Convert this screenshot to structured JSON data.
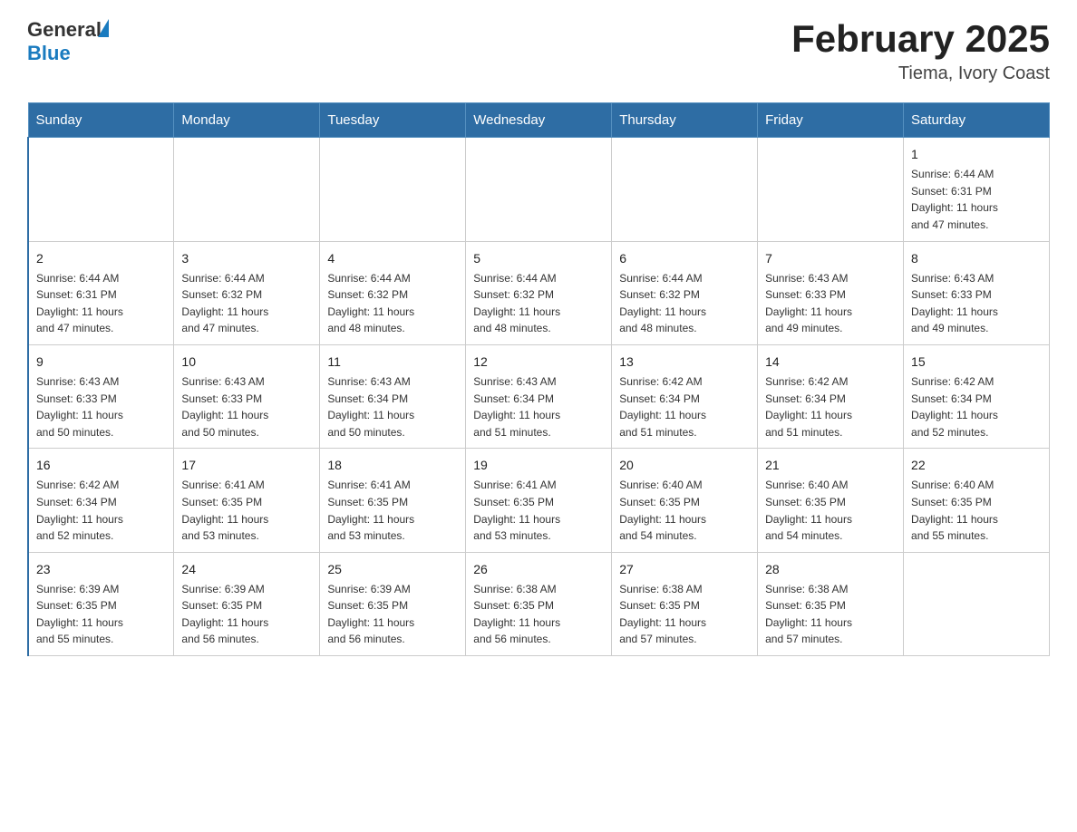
{
  "header": {
    "logo_general": "General",
    "logo_blue": "Blue",
    "title": "February 2025",
    "subtitle": "Tiema, Ivory Coast"
  },
  "weekdays": [
    "Sunday",
    "Monday",
    "Tuesday",
    "Wednesday",
    "Thursday",
    "Friday",
    "Saturday"
  ],
  "weeks": [
    [
      {
        "day": "",
        "info": ""
      },
      {
        "day": "",
        "info": ""
      },
      {
        "day": "",
        "info": ""
      },
      {
        "day": "",
        "info": ""
      },
      {
        "day": "",
        "info": ""
      },
      {
        "day": "",
        "info": ""
      },
      {
        "day": "1",
        "info": "Sunrise: 6:44 AM\nSunset: 6:31 PM\nDaylight: 11 hours\nand 47 minutes."
      }
    ],
    [
      {
        "day": "2",
        "info": "Sunrise: 6:44 AM\nSunset: 6:31 PM\nDaylight: 11 hours\nand 47 minutes."
      },
      {
        "day": "3",
        "info": "Sunrise: 6:44 AM\nSunset: 6:32 PM\nDaylight: 11 hours\nand 47 minutes."
      },
      {
        "day": "4",
        "info": "Sunrise: 6:44 AM\nSunset: 6:32 PM\nDaylight: 11 hours\nand 48 minutes."
      },
      {
        "day": "5",
        "info": "Sunrise: 6:44 AM\nSunset: 6:32 PM\nDaylight: 11 hours\nand 48 minutes."
      },
      {
        "day": "6",
        "info": "Sunrise: 6:44 AM\nSunset: 6:32 PM\nDaylight: 11 hours\nand 48 minutes."
      },
      {
        "day": "7",
        "info": "Sunrise: 6:43 AM\nSunset: 6:33 PM\nDaylight: 11 hours\nand 49 minutes."
      },
      {
        "day": "8",
        "info": "Sunrise: 6:43 AM\nSunset: 6:33 PM\nDaylight: 11 hours\nand 49 minutes."
      }
    ],
    [
      {
        "day": "9",
        "info": "Sunrise: 6:43 AM\nSunset: 6:33 PM\nDaylight: 11 hours\nand 50 minutes."
      },
      {
        "day": "10",
        "info": "Sunrise: 6:43 AM\nSunset: 6:33 PM\nDaylight: 11 hours\nand 50 minutes."
      },
      {
        "day": "11",
        "info": "Sunrise: 6:43 AM\nSunset: 6:34 PM\nDaylight: 11 hours\nand 50 minutes."
      },
      {
        "day": "12",
        "info": "Sunrise: 6:43 AM\nSunset: 6:34 PM\nDaylight: 11 hours\nand 51 minutes."
      },
      {
        "day": "13",
        "info": "Sunrise: 6:42 AM\nSunset: 6:34 PM\nDaylight: 11 hours\nand 51 minutes."
      },
      {
        "day": "14",
        "info": "Sunrise: 6:42 AM\nSunset: 6:34 PM\nDaylight: 11 hours\nand 51 minutes."
      },
      {
        "day": "15",
        "info": "Sunrise: 6:42 AM\nSunset: 6:34 PM\nDaylight: 11 hours\nand 52 minutes."
      }
    ],
    [
      {
        "day": "16",
        "info": "Sunrise: 6:42 AM\nSunset: 6:34 PM\nDaylight: 11 hours\nand 52 minutes."
      },
      {
        "day": "17",
        "info": "Sunrise: 6:41 AM\nSunset: 6:35 PM\nDaylight: 11 hours\nand 53 minutes."
      },
      {
        "day": "18",
        "info": "Sunrise: 6:41 AM\nSunset: 6:35 PM\nDaylight: 11 hours\nand 53 minutes."
      },
      {
        "day": "19",
        "info": "Sunrise: 6:41 AM\nSunset: 6:35 PM\nDaylight: 11 hours\nand 53 minutes."
      },
      {
        "day": "20",
        "info": "Sunrise: 6:40 AM\nSunset: 6:35 PM\nDaylight: 11 hours\nand 54 minutes."
      },
      {
        "day": "21",
        "info": "Sunrise: 6:40 AM\nSunset: 6:35 PM\nDaylight: 11 hours\nand 54 minutes."
      },
      {
        "day": "22",
        "info": "Sunrise: 6:40 AM\nSunset: 6:35 PM\nDaylight: 11 hours\nand 55 minutes."
      }
    ],
    [
      {
        "day": "23",
        "info": "Sunrise: 6:39 AM\nSunset: 6:35 PM\nDaylight: 11 hours\nand 55 minutes."
      },
      {
        "day": "24",
        "info": "Sunrise: 6:39 AM\nSunset: 6:35 PM\nDaylight: 11 hours\nand 56 minutes."
      },
      {
        "day": "25",
        "info": "Sunrise: 6:39 AM\nSunset: 6:35 PM\nDaylight: 11 hours\nand 56 minutes."
      },
      {
        "day": "26",
        "info": "Sunrise: 6:38 AM\nSunset: 6:35 PM\nDaylight: 11 hours\nand 56 minutes."
      },
      {
        "day": "27",
        "info": "Sunrise: 6:38 AM\nSunset: 6:35 PM\nDaylight: 11 hours\nand 57 minutes."
      },
      {
        "day": "28",
        "info": "Sunrise: 6:38 AM\nSunset: 6:35 PM\nDaylight: 11 hours\nand 57 minutes."
      },
      {
        "day": "",
        "info": ""
      }
    ]
  ]
}
